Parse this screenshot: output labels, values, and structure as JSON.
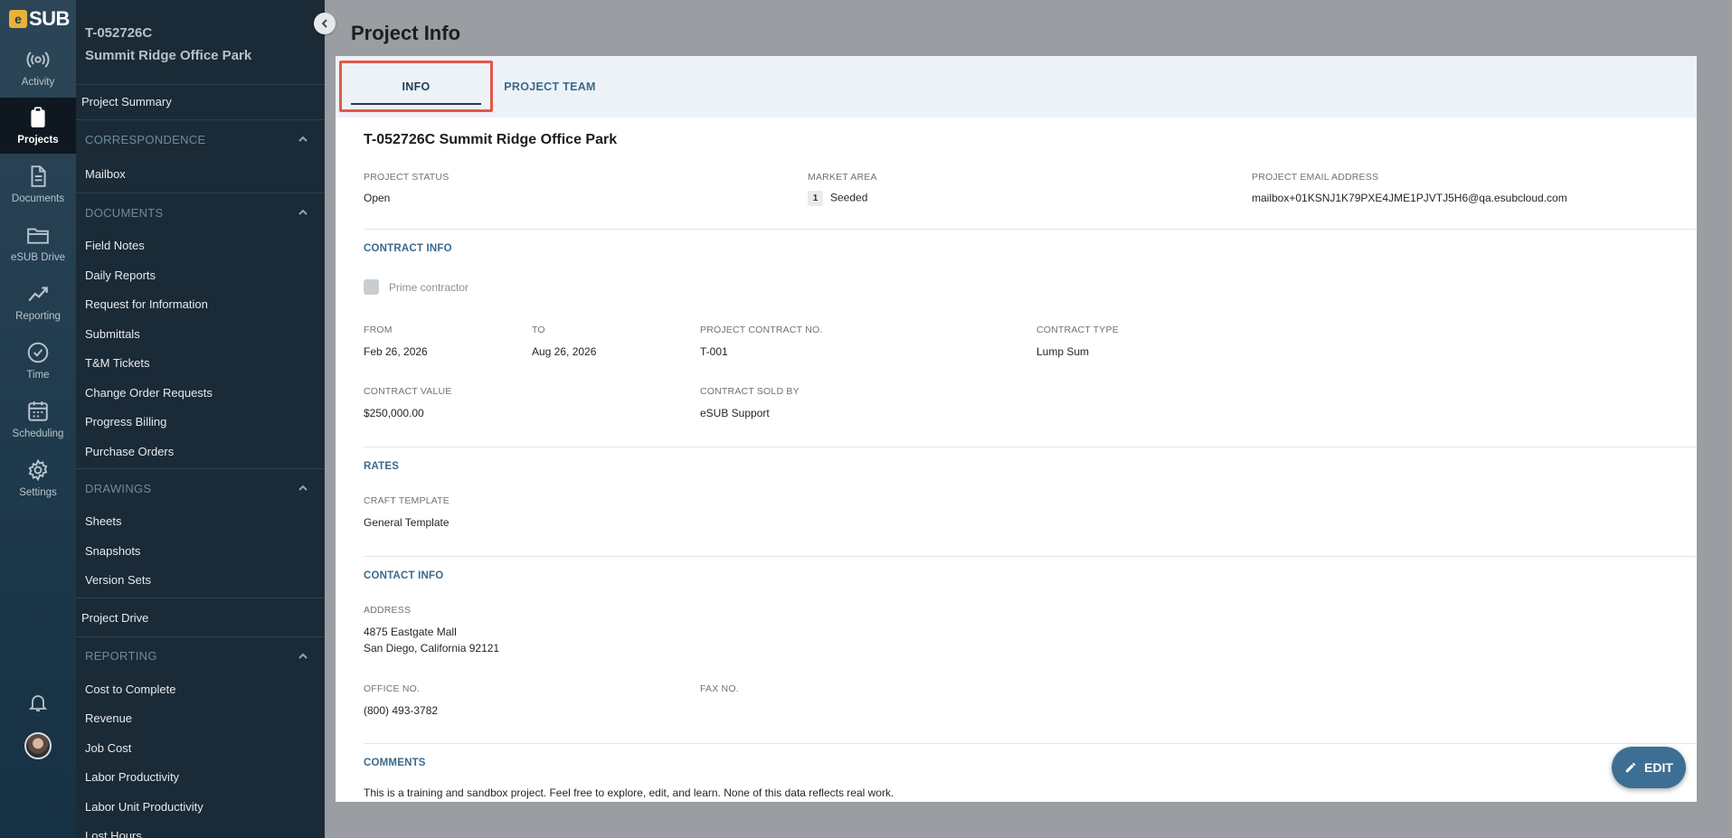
{
  "brand": {
    "logo_letter": "e",
    "logo_text": "SUB"
  },
  "rail": [
    {
      "label": "Activity",
      "icon": "broadcast-icon"
    },
    {
      "label": "Projects",
      "icon": "clipboard-icon"
    },
    {
      "label": "Documents",
      "icon": "document-icon"
    },
    {
      "label": "eSUB Drive",
      "icon": "folder-icon"
    },
    {
      "label": "Reporting",
      "icon": "chart-line-icon"
    },
    {
      "label": "Time",
      "icon": "clock-icon"
    },
    {
      "label": "Scheduling",
      "icon": "calendar-icon"
    },
    {
      "label": "Settings",
      "icon": "gear-icon"
    }
  ],
  "project": {
    "number": "T-052726C",
    "name": "Summit Ridge Office Park"
  },
  "nav": {
    "summary": "Project Summary",
    "correspondence": {
      "title": "CORRESPONDENCE",
      "items": [
        "Mailbox"
      ]
    },
    "documents": {
      "title": "DOCUMENTS",
      "items": [
        "Field Notes",
        "Daily Reports",
        "Request for Information",
        "Submittals",
        "T&M Tickets",
        "Change Order Requests",
        "Progress Billing",
        "Purchase Orders"
      ]
    },
    "drawings": {
      "title": "DRAWINGS",
      "items": [
        "Sheets",
        "Snapshots",
        "Version Sets"
      ]
    },
    "drive": "Project Drive",
    "reporting": {
      "title": "REPORTING",
      "items": [
        "Cost to Complete",
        "Revenue",
        "Job Cost",
        "Labor Productivity",
        "Labor Unit Productivity",
        "Lost Hours"
      ]
    }
  },
  "page": {
    "title": "Project Info"
  },
  "tabs": {
    "info": "INFO",
    "team": "PROJECT TEAM"
  },
  "info": {
    "heading": "T-052726C Summit Ridge Office Park",
    "status_label": "PROJECT STATUS",
    "status": "Open",
    "market_label": "MARKET AREA",
    "market_badge": "1",
    "market": "Seeded",
    "email_label": "PROJECT EMAIL ADDRESS",
    "email": "mailbox+01KSNJ1K79PXE4JME1PJVTJ5H6@qa.esubcloud.com"
  },
  "contract": {
    "title": "CONTRACT INFO",
    "prime_label": "Prime contractor",
    "from_label": "FROM",
    "from": "Feb 26, 2026",
    "to_label": "TO",
    "to": "Aug 26, 2026",
    "no_label": "PROJECT CONTRACT NO.",
    "no": "T-001",
    "type_label": "CONTRACT TYPE",
    "type": "Lump Sum",
    "value_label": "CONTRACT VALUE",
    "value": "$250,000.00",
    "sold_label": "CONTRACT SOLD BY",
    "sold": "eSUB Support"
  },
  "rates": {
    "title": "RATES",
    "craft_label": "CRAFT TEMPLATE",
    "craft": "General Template"
  },
  "contact": {
    "title": "CONTACT INFO",
    "address_label": "ADDRESS",
    "address1": "4875 Eastgate Mall",
    "address2": "San Diego, California 92121",
    "office_label": "OFFICE NO.",
    "office": "(800) 493-3782",
    "fax_label": "FAX NO.",
    "fax": ""
  },
  "comments": {
    "title": "COMMENTS",
    "text": "This is a training and sandbox project. Feel free to explore, edit, and learn. None of this data reflects real work."
  },
  "edit_label": "EDIT"
}
